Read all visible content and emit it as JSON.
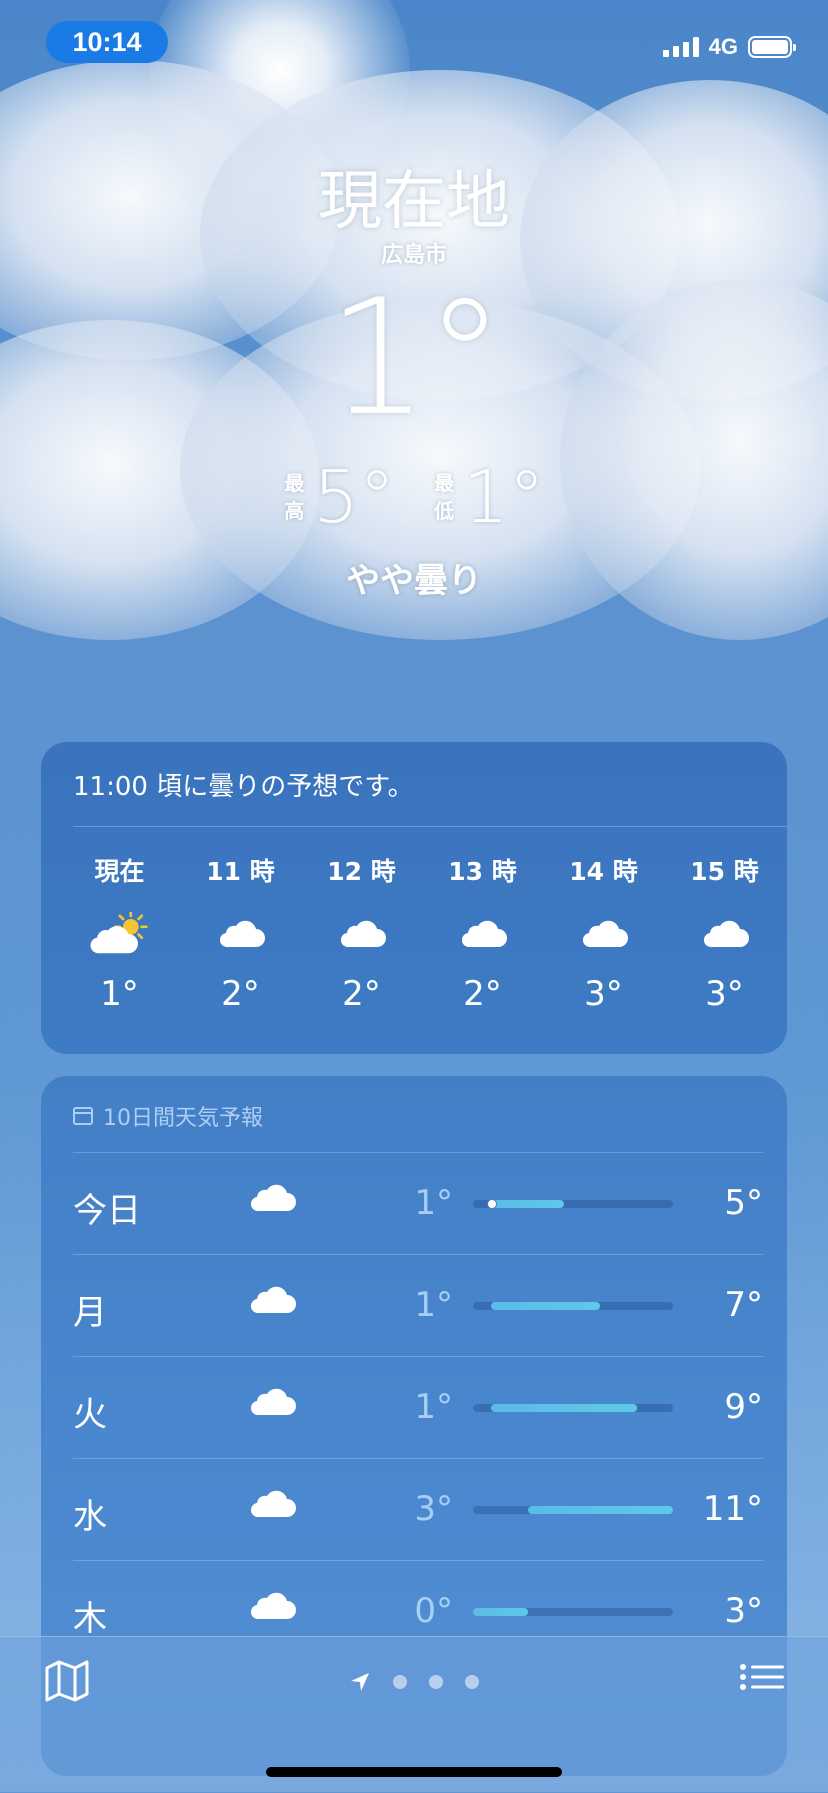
{
  "status_bar": {
    "time": "10:14",
    "network": "4G",
    "battery_percent": 100,
    "signal_bars": 4
  },
  "header": {
    "location": "現在地",
    "city": "広島市",
    "current_temp": "1°",
    "high_label": "最高",
    "high": "5°",
    "low_label": "最低",
    "low": "1°",
    "condition": "やや曇り"
  },
  "hourly": {
    "summary": "11:00 頃に曇りの予想です。",
    "items": [
      {
        "label": "現在",
        "icon": "partly-sunny-icon",
        "temp": "1°"
      },
      {
        "label": "11 時",
        "icon": "cloud-icon",
        "temp": "2°"
      },
      {
        "label": "12 時",
        "icon": "cloud-icon",
        "temp": "2°"
      },
      {
        "label": "13 時",
        "icon": "cloud-icon",
        "temp": "2°"
      },
      {
        "label": "14 時",
        "icon": "cloud-icon",
        "temp": "3°"
      },
      {
        "label": "15 時",
        "icon": "cloud-icon",
        "temp": "3°"
      }
    ]
  },
  "daily": {
    "title": "10日間天気予報",
    "range_min": 0,
    "range_max": 11,
    "days": [
      {
        "day": "今日",
        "icon": "cloud-icon",
        "low_label": "1°",
        "high_label": "5°",
        "low": 1,
        "high": 5,
        "current": 1
      },
      {
        "day": "月",
        "icon": "cloud-icon",
        "low_label": "1°",
        "high_label": "7°",
        "low": 1,
        "high": 7
      },
      {
        "day": "火",
        "icon": "cloud-icon",
        "low_label": "1°",
        "high_label": "9°",
        "low": 1,
        "high": 9
      },
      {
        "day": "水",
        "icon": "cloud-icon",
        "low_label": "3°",
        "high_label": "11°",
        "low": 3,
        "high": 11
      },
      {
        "day": "木",
        "icon": "cloud-icon",
        "low_label": "0°",
        "high_label": "3°",
        "low": 0,
        "high": 3
      }
    ]
  },
  "toolbar": {
    "page_count": 3,
    "active_page": 0
  }
}
